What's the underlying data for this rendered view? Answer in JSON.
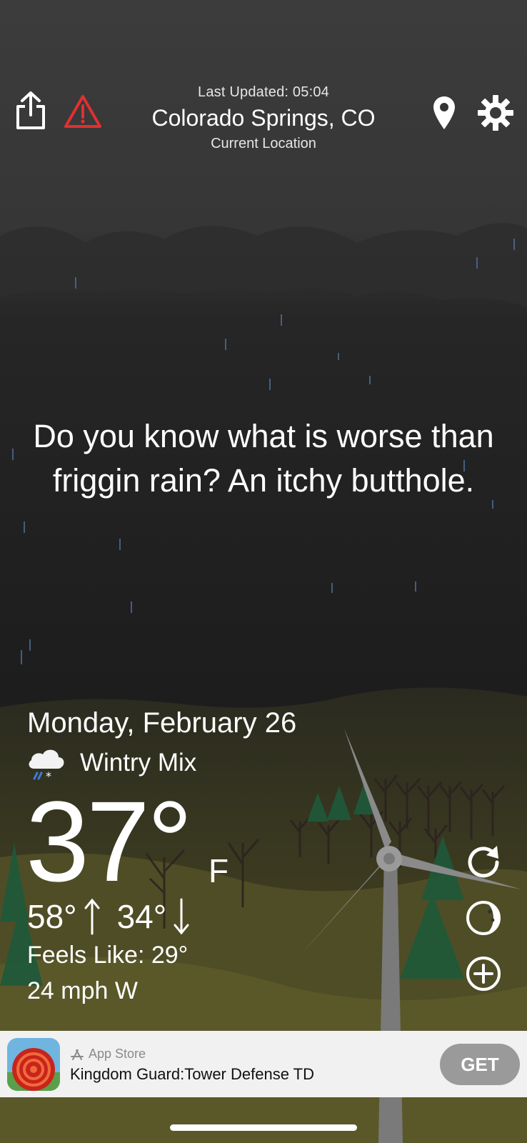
{
  "header": {
    "last_updated": "Last Updated: 05:04",
    "city": "Colorado Springs, CO",
    "location_label": "Current Location"
  },
  "quote": "Do you know what is worse than friggin rain? An itchy butthole.",
  "weather": {
    "date": "Monday, February 26",
    "condition": "Wintry Mix",
    "temperature": "37°",
    "unit": "F",
    "high": "58°",
    "low": "34°",
    "feels_like": "Feels Like: 29°",
    "wind": "24 mph W"
  },
  "ad": {
    "store": "App Store",
    "title": "Kingdom Guard:Tower Defense TD",
    "cta": "GET"
  },
  "colors": {
    "sky_top": "#3a3a3a",
    "sky_dark": "#1e1e1e",
    "hill": "#3f3f22",
    "alert_red": "#e03030",
    "rain": "#5a7fa8",
    "ad_bg": "#f1f1f1",
    "get_button": "#9a9a9a"
  },
  "icons": [
    "share-icon",
    "alert-icon",
    "location-pin-icon",
    "gear-icon",
    "wintry-mix-icon",
    "refresh-icon",
    "moon-phase-icon",
    "add-location-icon",
    "app-store-icon"
  ]
}
